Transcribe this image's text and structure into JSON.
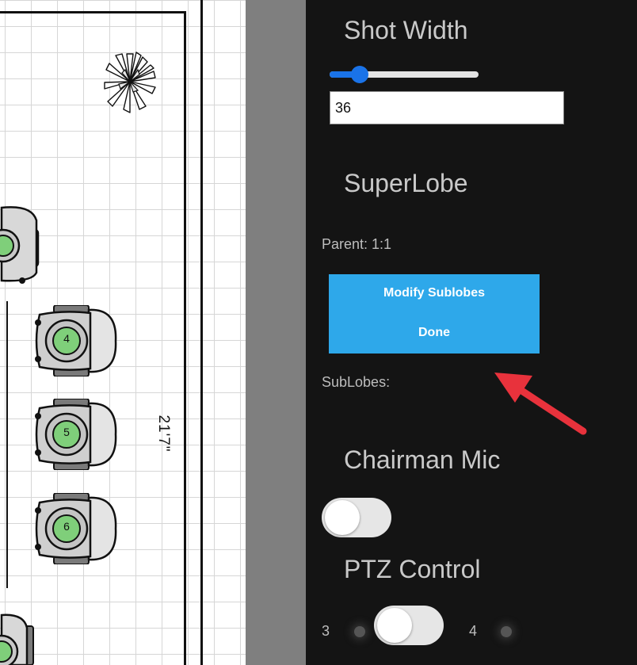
{
  "canvas": {
    "seats": [
      {
        "number": "4"
      },
      {
        "number": "5"
      },
      {
        "number": "6"
      }
    ],
    "dimension_label": "21'7\""
  },
  "panel": {
    "shot_width": {
      "heading": "Shot Width",
      "slider_fraction": 0.2,
      "value": "36"
    },
    "superlobe": {
      "heading": "SuperLobe",
      "parent_label": "Parent: 1:1",
      "modify_label": "Modify Sublobes",
      "done_label": "Done",
      "sublobes_label": "SubLobes:"
    },
    "chairman_mic": {
      "heading": "Chairman Mic",
      "enabled": false
    },
    "ptz_control": {
      "heading": "PTZ Control",
      "left_value": "3",
      "right_value": "4"
    }
  },
  "colors": {
    "panel_bg": "#141414",
    "accent_blue": "#2ea8ea",
    "slider_blue": "#1a73e8",
    "seat_green": "#7fcf7a",
    "annotation_red": "#e8323c"
  }
}
